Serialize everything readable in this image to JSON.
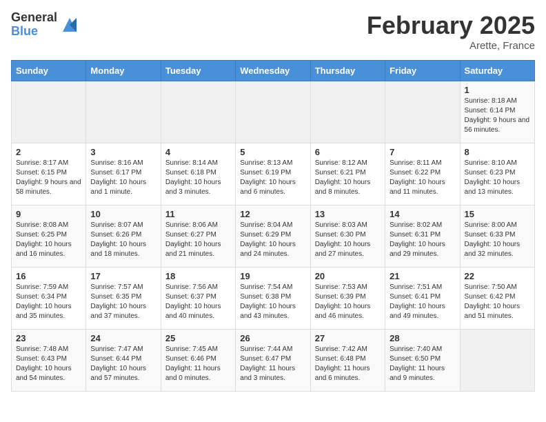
{
  "header": {
    "logo_general": "General",
    "logo_blue": "Blue",
    "month_title": "February 2025",
    "location": "Arette, France"
  },
  "days_of_week": [
    "Sunday",
    "Monday",
    "Tuesday",
    "Wednesday",
    "Thursday",
    "Friday",
    "Saturday"
  ],
  "weeks": [
    [
      {
        "day": "",
        "info": ""
      },
      {
        "day": "",
        "info": ""
      },
      {
        "day": "",
        "info": ""
      },
      {
        "day": "",
        "info": ""
      },
      {
        "day": "",
        "info": ""
      },
      {
        "day": "",
        "info": ""
      },
      {
        "day": "1",
        "info": "Sunrise: 8:18 AM\nSunset: 6:14 PM\nDaylight: 9 hours and 56 minutes."
      }
    ],
    [
      {
        "day": "2",
        "info": "Sunrise: 8:17 AM\nSunset: 6:15 PM\nDaylight: 9 hours and 58 minutes."
      },
      {
        "day": "3",
        "info": "Sunrise: 8:16 AM\nSunset: 6:17 PM\nDaylight: 10 hours and 1 minute."
      },
      {
        "day": "4",
        "info": "Sunrise: 8:14 AM\nSunset: 6:18 PM\nDaylight: 10 hours and 3 minutes."
      },
      {
        "day": "5",
        "info": "Sunrise: 8:13 AM\nSunset: 6:19 PM\nDaylight: 10 hours and 6 minutes."
      },
      {
        "day": "6",
        "info": "Sunrise: 8:12 AM\nSunset: 6:21 PM\nDaylight: 10 hours and 8 minutes."
      },
      {
        "day": "7",
        "info": "Sunrise: 8:11 AM\nSunset: 6:22 PM\nDaylight: 10 hours and 11 minutes."
      },
      {
        "day": "8",
        "info": "Sunrise: 8:10 AM\nSunset: 6:23 PM\nDaylight: 10 hours and 13 minutes."
      }
    ],
    [
      {
        "day": "9",
        "info": "Sunrise: 8:08 AM\nSunset: 6:25 PM\nDaylight: 10 hours and 16 minutes."
      },
      {
        "day": "10",
        "info": "Sunrise: 8:07 AM\nSunset: 6:26 PM\nDaylight: 10 hours and 18 minutes."
      },
      {
        "day": "11",
        "info": "Sunrise: 8:06 AM\nSunset: 6:27 PM\nDaylight: 10 hours and 21 minutes."
      },
      {
        "day": "12",
        "info": "Sunrise: 8:04 AM\nSunset: 6:29 PM\nDaylight: 10 hours and 24 minutes."
      },
      {
        "day": "13",
        "info": "Sunrise: 8:03 AM\nSunset: 6:30 PM\nDaylight: 10 hours and 27 minutes."
      },
      {
        "day": "14",
        "info": "Sunrise: 8:02 AM\nSunset: 6:31 PM\nDaylight: 10 hours and 29 minutes."
      },
      {
        "day": "15",
        "info": "Sunrise: 8:00 AM\nSunset: 6:33 PM\nDaylight: 10 hours and 32 minutes."
      }
    ],
    [
      {
        "day": "16",
        "info": "Sunrise: 7:59 AM\nSunset: 6:34 PM\nDaylight: 10 hours and 35 minutes."
      },
      {
        "day": "17",
        "info": "Sunrise: 7:57 AM\nSunset: 6:35 PM\nDaylight: 10 hours and 37 minutes."
      },
      {
        "day": "18",
        "info": "Sunrise: 7:56 AM\nSunset: 6:37 PM\nDaylight: 10 hours and 40 minutes."
      },
      {
        "day": "19",
        "info": "Sunrise: 7:54 AM\nSunset: 6:38 PM\nDaylight: 10 hours and 43 minutes."
      },
      {
        "day": "20",
        "info": "Sunrise: 7:53 AM\nSunset: 6:39 PM\nDaylight: 10 hours and 46 minutes."
      },
      {
        "day": "21",
        "info": "Sunrise: 7:51 AM\nSunset: 6:41 PM\nDaylight: 10 hours and 49 minutes."
      },
      {
        "day": "22",
        "info": "Sunrise: 7:50 AM\nSunset: 6:42 PM\nDaylight: 10 hours and 51 minutes."
      }
    ],
    [
      {
        "day": "23",
        "info": "Sunrise: 7:48 AM\nSunset: 6:43 PM\nDaylight: 10 hours and 54 minutes."
      },
      {
        "day": "24",
        "info": "Sunrise: 7:47 AM\nSunset: 6:44 PM\nDaylight: 10 hours and 57 minutes."
      },
      {
        "day": "25",
        "info": "Sunrise: 7:45 AM\nSunset: 6:46 PM\nDaylight: 11 hours and 0 minutes."
      },
      {
        "day": "26",
        "info": "Sunrise: 7:44 AM\nSunset: 6:47 PM\nDaylight: 11 hours and 3 minutes."
      },
      {
        "day": "27",
        "info": "Sunrise: 7:42 AM\nSunset: 6:48 PM\nDaylight: 11 hours and 6 minutes."
      },
      {
        "day": "28",
        "info": "Sunrise: 7:40 AM\nSunset: 6:50 PM\nDaylight: 11 hours and 9 minutes."
      },
      {
        "day": "",
        "info": ""
      }
    ]
  ]
}
